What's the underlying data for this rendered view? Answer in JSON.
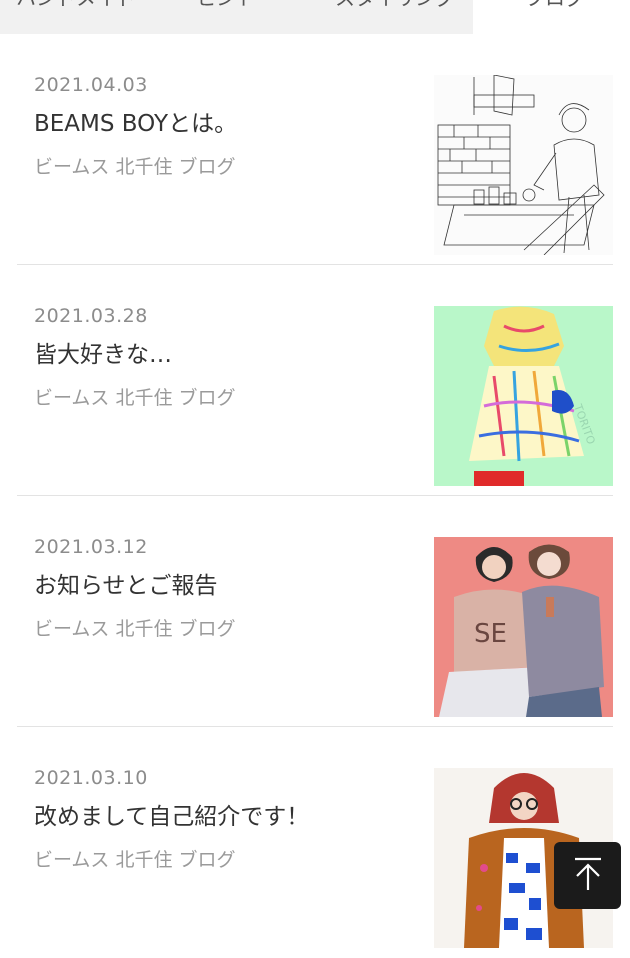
{
  "tabs": [
    {
      "label": "ハンドメイド",
      "active": false
    },
    {
      "label": "ヒント",
      "active": false
    },
    {
      "label": "スタイリング",
      "active": false
    },
    {
      "label": "ブログ",
      "active": true
    }
  ],
  "posts": [
    {
      "date": "2021.04.03",
      "title": "BEAMS BOYとは。",
      "category": "ビームス 北千住 ブログ",
      "thumbnail": "sketch-illustration-kitchen"
    },
    {
      "date": "2021.03.28",
      "title": "皆大好きな…",
      "category": "ビームス 北千住 ブログ",
      "thumbnail": "illustration-colorful-dress-green"
    },
    {
      "date": "2021.03.12",
      "title": "お知らせとご報告",
      "category": "ビームス 北千住 ブログ",
      "thumbnail": "illustration-two-women-pink"
    },
    {
      "date": "2021.03.10",
      "title": "改めまして自己紹介です！",
      "category": "ビームス 北千住 ブログ",
      "thumbnail": "illustration-woman-brown-jacket"
    }
  ],
  "back_to_top": {
    "icon": "arrow-up-icon"
  },
  "colors": {
    "tab_inactive_bg": "#f1f1f1",
    "divider": "#e3e3e3",
    "date_text": "#8c8c8c",
    "category_text": "#9a9a9a",
    "button_bg": "#1b1b1b"
  }
}
